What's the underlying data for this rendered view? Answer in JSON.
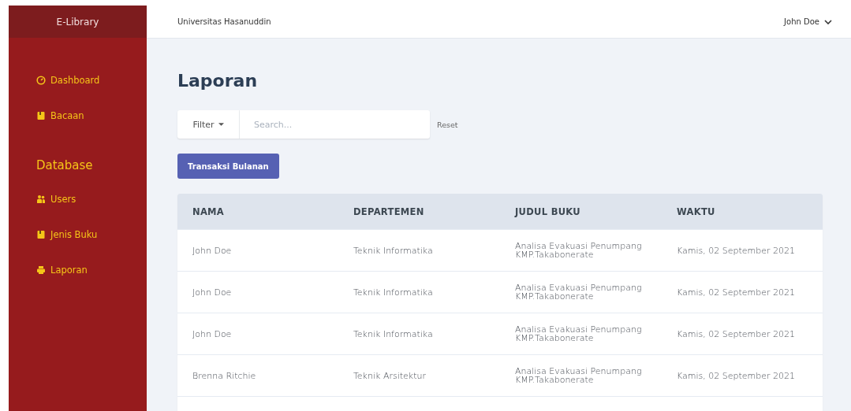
{
  "brand": "E-Library",
  "header": {
    "institution": "Universitas Hasanuddin",
    "user": "John Doe"
  },
  "sidebar": {
    "items": [
      {
        "label": "Dashboard",
        "kind": "gauge",
        "selected": false
      },
      {
        "label": "Bacaan",
        "kind": "book",
        "selected": false
      }
    ],
    "section": "Database",
    "section_items": [
      {
        "label": "Users",
        "kind": "users",
        "selected": false
      },
      {
        "label": "Jenis Buku",
        "kind": "book",
        "selected": false
      },
      {
        "label": "Laporan",
        "kind": "printer",
        "selected": false
      }
    ]
  },
  "page_title": "Laporan",
  "filter": {
    "label": "Filter",
    "placeholder": "Search...",
    "reset": "Reset"
  },
  "action_button": "Transaksi Bulanan",
  "table": {
    "columns": [
      "NAMA",
      "DEPARTEMEN",
      "JUDUL BUKU",
      "WAKTU"
    ],
    "rows": [
      [
        "John Doe",
        "Teknik Informatika",
        "Analisa Evakuasi Penumpang KMP.Takabonerate",
        "Kamis, 02 September 2021"
      ],
      [
        "John Doe",
        "Teknik Informatika",
        "Analisa Evakuasi Penumpang KMP.Takabonerate",
        "Kamis, 02 September 2021"
      ],
      [
        "John Doe",
        "Teknik Informatika",
        "Analisa Evakuasi Penumpang KMP.Takabonerate",
        "Kamis, 02 September 2021"
      ],
      [
        "Brenna Ritchie",
        "Teknik Arsitektur",
        "Analisa Evakuasi Penumpang KMP.Takabonerate",
        "Kamis, 02 September 2021"
      ]
    ]
  }
}
